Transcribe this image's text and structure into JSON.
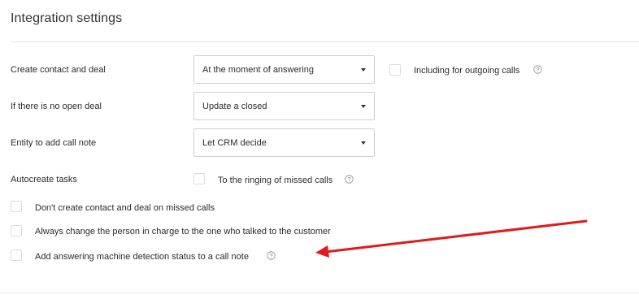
{
  "header": {
    "title": "Integration settings"
  },
  "settings": {
    "create_contact": {
      "label": "Create contact and deal",
      "value": "At the moment of answering"
    },
    "outgoing": {
      "label": "Including for outgoing calls"
    },
    "no_open_deal": {
      "label": "If there is no open deal",
      "value": "Update a closed"
    },
    "entity_note": {
      "label": "Entity to add call note",
      "value": "Let CRM decide"
    },
    "autocreate": {
      "label": "Autocreate tasks",
      "option_label": "To the ringing of missed calls"
    },
    "missed_calls": {
      "label": "Don't create contact and deal on missed calls"
    },
    "change_person": {
      "label": "Always change the person in charge to the one who talked to the customer"
    },
    "amd_status": {
      "label": "Add answering machine detection status to a call note"
    }
  },
  "colors": {
    "arrow": "#e01b1b",
    "border": "#cfcfcf",
    "checkbox_border": "#dcdcdc",
    "help_icon": "#9a9a9a"
  },
  "icons": {
    "help": "question-circle-icon",
    "select_caret": "caret-down-icon"
  }
}
